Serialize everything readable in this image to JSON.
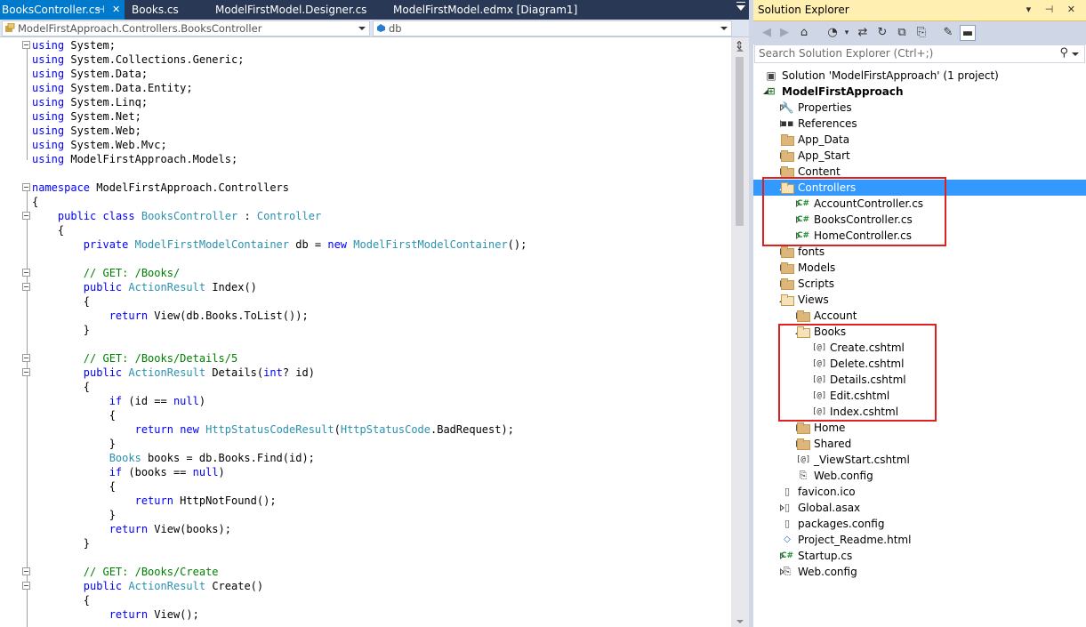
{
  "editor": {
    "tabs": [
      {
        "label": "BooksController.cs",
        "pin": "⊣",
        "close": "✕"
      },
      {
        "label": "Books.cs"
      },
      {
        "label": "ModelFirstModel.Designer.cs"
      },
      {
        "label": "ModelFirstModel.edmx [Diagram1]"
      }
    ],
    "nav_left": "ModelFirstApproach.Controllers.BooksController",
    "nav_right": "db",
    "split_glyph": "⇕"
  },
  "code_lines": [
    {
      "parts": [
        {
          "t": "using",
          "c": "kw"
        },
        {
          "t": " System;"
        }
      ]
    },
    {
      "parts": [
        {
          "t": "using",
          "c": "kw"
        },
        {
          "t": " System.Collections.Generic;"
        }
      ]
    },
    {
      "parts": [
        {
          "t": "using",
          "c": "kw"
        },
        {
          "t": " System.Data;"
        }
      ]
    },
    {
      "parts": [
        {
          "t": "using",
          "c": "kw"
        },
        {
          "t": " System.Data.Entity;"
        }
      ]
    },
    {
      "parts": [
        {
          "t": "using",
          "c": "kw"
        },
        {
          "t": " System.Linq;"
        }
      ]
    },
    {
      "parts": [
        {
          "t": "using",
          "c": "kw"
        },
        {
          "t": " System.Net;"
        }
      ]
    },
    {
      "parts": [
        {
          "t": "using",
          "c": "kw"
        },
        {
          "t": " System.Web;"
        }
      ]
    },
    {
      "parts": [
        {
          "t": "using",
          "c": "kw"
        },
        {
          "t": " System.Web.Mvc;"
        }
      ]
    },
    {
      "parts": [
        {
          "t": "using",
          "c": "kw"
        },
        {
          "t": " ModelFirstApproach.Models;"
        }
      ]
    },
    {
      "parts": []
    },
    {
      "parts": [
        {
          "t": "namespace",
          "c": "kw"
        },
        {
          "t": " ModelFirstApproach.Controllers"
        }
      ]
    },
    {
      "parts": [
        {
          "t": "{"
        }
      ]
    },
    {
      "parts": [
        {
          "t": "    "
        },
        {
          "t": "public",
          "c": "kw"
        },
        {
          "t": " "
        },
        {
          "t": "class",
          "c": "kw"
        },
        {
          "t": " "
        },
        {
          "t": "BooksController",
          "c": "ty"
        },
        {
          "t": " : "
        },
        {
          "t": "Controller",
          "c": "ty"
        }
      ]
    },
    {
      "parts": [
        {
          "t": "    {"
        }
      ]
    },
    {
      "parts": [
        {
          "t": "        "
        },
        {
          "t": "private",
          "c": "kw"
        },
        {
          "t": " "
        },
        {
          "t": "ModelFirstModelContainer",
          "c": "ty"
        },
        {
          "t": " db = "
        },
        {
          "t": "new",
          "c": "kw"
        },
        {
          "t": " "
        },
        {
          "t": "ModelFirstModelContainer",
          "c": "ty"
        },
        {
          "t": "();"
        }
      ]
    },
    {
      "parts": []
    },
    {
      "parts": [
        {
          "t": "        "
        },
        {
          "t": "// GET: /Books/",
          "c": "cm"
        }
      ]
    },
    {
      "parts": [
        {
          "t": "        "
        },
        {
          "t": "public",
          "c": "kw"
        },
        {
          "t": " "
        },
        {
          "t": "ActionResult",
          "c": "ty"
        },
        {
          "t": " Index()"
        }
      ]
    },
    {
      "parts": [
        {
          "t": "        {"
        }
      ]
    },
    {
      "parts": [
        {
          "t": "            "
        },
        {
          "t": "return",
          "c": "kw"
        },
        {
          "t": " View(db.Books.ToList());"
        }
      ]
    },
    {
      "parts": [
        {
          "t": "        }"
        }
      ]
    },
    {
      "parts": []
    },
    {
      "parts": [
        {
          "t": "        "
        },
        {
          "t": "// GET: /Books/Details/5",
          "c": "cm"
        }
      ]
    },
    {
      "parts": [
        {
          "t": "        "
        },
        {
          "t": "public",
          "c": "kw"
        },
        {
          "t": " "
        },
        {
          "t": "ActionResult",
          "c": "ty"
        },
        {
          "t": " Details("
        },
        {
          "t": "int",
          "c": "kw"
        },
        {
          "t": "? id)"
        }
      ]
    },
    {
      "parts": [
        {
          "t": "        {"
        }
      ]
    },
    {
      "parts": [
        {
          "t": "            "
        },
        {
          "t": "if",
          "c": "kw"
        },
        {
          "t": " (id == "
        },
        {
          "t": "null",
          "c": "kw"
        },
        {
          "t": ")"
        }
      ]
    },
    {
      "parts": [
        {
          "t": "            {"
        }
      ]
    },
    {
      "parts": [
        {
          "t": "                "
        },
        {
          "t": "return",
          "c": "kw"
        },
        {
          "t": " "
        },
        {
          "t": "new",
          "c": "kw"
        },
        {
          "t": " "
        },
        {
          "t": "HttpStatusCodeResult",
          "c": "ty"
        },
        {
          "t": "("
        },
        {
          "t": "HttpStatusCode",
          "c": "ty"
        },
        {
          "t": ".BadRequest);"
        }
      ]
    },
    {
      "parts": [
        {
          "t": "            }"
        }
      ]
    },
    {
      "parts": [
        {
          "t": "            "
        },
        {
          "t": "Books",
          "c": "ty"
        },
        {
          "t": " books = db.Books.Find(id);"
        }
      ]
    },
    {
      "parts": [
        {
          "t": "            "
        },
        {
          "t": "if",
          "c": "kw"
        },
        {
          "t": " (books == "
        },
        {
          "t": "null",
          "c": "kw"
        },
        {
          "t": ")"
        }
      ]
    },
    {
      "parts": [
        {
          "t": "            {"
        }
      ]
    },
    {
      "parts": [
        {
          "t": "                "
        },
        {
          "t": "return",
          "c": "kw"
        },
        {
          "t": " HttpNotFound();"
        }
      ]
    },
    {
      "parts": [
        {
          "t": "            }"
        }
      ]
    },
    {
      "parts": [
        {
          "t": "            "
        },
        {
          "t": "return",
          "c": "kw"
        },
        {
          "t": " View(books);"
        }
      ]
    },
    {
      "parts": [
        {
          "t": "        }"
        }
      ]
    },
    {
      "parts": []
    },
    {
      "parts": [
        {
          "t": "        "
        },
        {
          "t": "// GET: /Books/Create",
          "c": "cm"
        }
      ]
    },
    {
      "parts": [
        {
          "t": "        "
        },
        {
          "t": "public",
          "c": "kw"
        },
        {
          "t": " "
        },
        {
          "t": "ActionResult",
          "c": "ty"
        },
        {
          "t": " Create()"
        }
      ]
    },
    {
      "parts": [
        {
          "t": "        {"
        }
      ]
    },
    {
      "parts": [
        {
          "t": "            "
        },
        {
          "t": "return",
          "c": "kw"
        },
        {
          "t": " View();"
        }
      ]
    }
  ],
  "solution_explorer": {
    "title": "Solution Explorer",
    "title_buttons": "▾ ⊣ ✕",
    "search_placeholder": "Search Solution Explorer (Ctrl+;)",
    "toolbar_icons": [
      "back-icon",
      "forward-icon",
      "home-icon",
      "history-icon",
      "dropdown-icon",
      "sync-icon",
      "refresh-icon",
      "collapse-all-icon",
      "show-all-files-icon",
      "properties-icon",
      "preview-icon"
    ],
    "tree": [
      {
        "label": "Solution 'ModelFirstApproach' (1 project)",
        "indent": 0,
        "exp": "none",
        "icon": "solution"
      },
      {
        "label": "ModelFirstApproach",
        "indent": 0,
        "exp": "expanded",
        "icon": "project",
        "bold": true
      },
      {
        "label": "Properties",
        "indent": 1,
        "exp": "collapsed",
        "icon": "wrench"
      },
      {
        "label": "References",
        "indent": 1,
        "exp": "collapsed",
        "icon": "refs"
      },
      {
        "label": "App_Data",
        "indent": 1,
        "exp": "none",
        "icon": "folder"
      },
      {
        "label": "App_Start",
        "indent": 1,
        "exp": "collapsed",
        "icon": "folder"
      },
      {
        "label": "Content",
        "indent": 1,
        "exp": "collapsed",
        "icon": "folder"
      },
      {
        "label": "Controllers",
        "indent": 1,
        "exp": "expanded",
        "icon": "folder-open",
        "selected": true
      },
      {
        "label": "AccountController.cs",
        "indent": 2,
        "exp": "collapsed",
        "icon": "cs"
      },
      {
        "label": "BooksController.cs",
        "indent": 2,
        "exp": "collapsed",
        "icon": "cs"
      },
      {
        "label": "HomeController.cs",
        "indent": 2,
        "exp": "collapsed",
        "icon": "cs"
      },
      {
        "label": "fonts",
        "indent": 1,
        "exp": "collapsed",
        "icon": "folder"
      },
      {
        "label": "Models",
        "indent": 1,
        "exp": "collapsed",
        "icon": "folder"
      },
      {
        "label": "Scripts",
        "indent": 1,
        "exp": "collapsed",
        "icon": "folder"
      },
      {
        "label": "Views",
        "indent": 1,
        "exp": "expanded",
        "icon": "folder-open"
      },
      {
        "label": "Account",
        "indent": 2,
        "exp": "collapsed",
        "icon": "folder"
      },
      {
        "label": "Books",
        "indent": 2,
        "exp": "expanded",
        "icon": "folder-open"
      },
      {
        "label": "Create.cshtml",
        "indent": 3,
        "exp": "none",
        "icon": "cshtml"
      },
      {
        "label": "Delete.cshtml",
        "indent": 3,
        "exp": "none",
        "icon": "cshtml"
      },
      {
        "label": "Details.cshtml",
        "indent": 3,
        "exp": "none",
        "icon": "cshtml"
      },
      {
        "label": "Edit.cshtml",
        "indent": 3,
        "exp": "none",
        "icon": "cshtml"
      },
      {
        "label": "Index.cshtml",
        "indent": 3,
        "exp": "none",
        "icon": "cshtml"
      },
      {
        "label": "Home",
        "indent": 2,
        "exp": "collapsed",
        "icon": "folder"
      },
      {
        "label": "Shared",
        "indent": 2,
        "exp": "collapsed",
        "icon": "folder"
      },
      {
        "label": "_ViewStart.cshtml",
        "indent": 2,
        "exp": "none",
        "icon": "cshtml"
      },
      {
        "label": "Web.config",
        "indent": 2,
        "exp": "none",
        "icon": "config"
      },
      {
        "label": "favicon.ico",
        "indent": 1,
        "exp": "none",
        "icon": "file"
      },
      {
        "label": "Global.asax",
        "indent": 1,
        "exp": "collapsed",
        "icon": "file"
      },
      {
        "label": "packages.config",
        "indent": 1,
        "exp": "none",
        "icon": "file"
      },
      {
        "label": "Project_Readme.html",
        "indent": 1,
        "exp": "none",
        "icon": "html"
      },
      {
        "label": "Startup.cs",
        "indent": 1,
        "exp": "collapsed",
        "icon": "cs"
      },
      {
        "label": "Web.config",
        "indent": 1,
        "exp": "collapsed",
        "icon": "config"
      }
    ]
  },
  "colors": {
    "highlight_box": "#e02020",
    "selection": "#3399ff",
    "active_tab": "#007acc"
  }
}
